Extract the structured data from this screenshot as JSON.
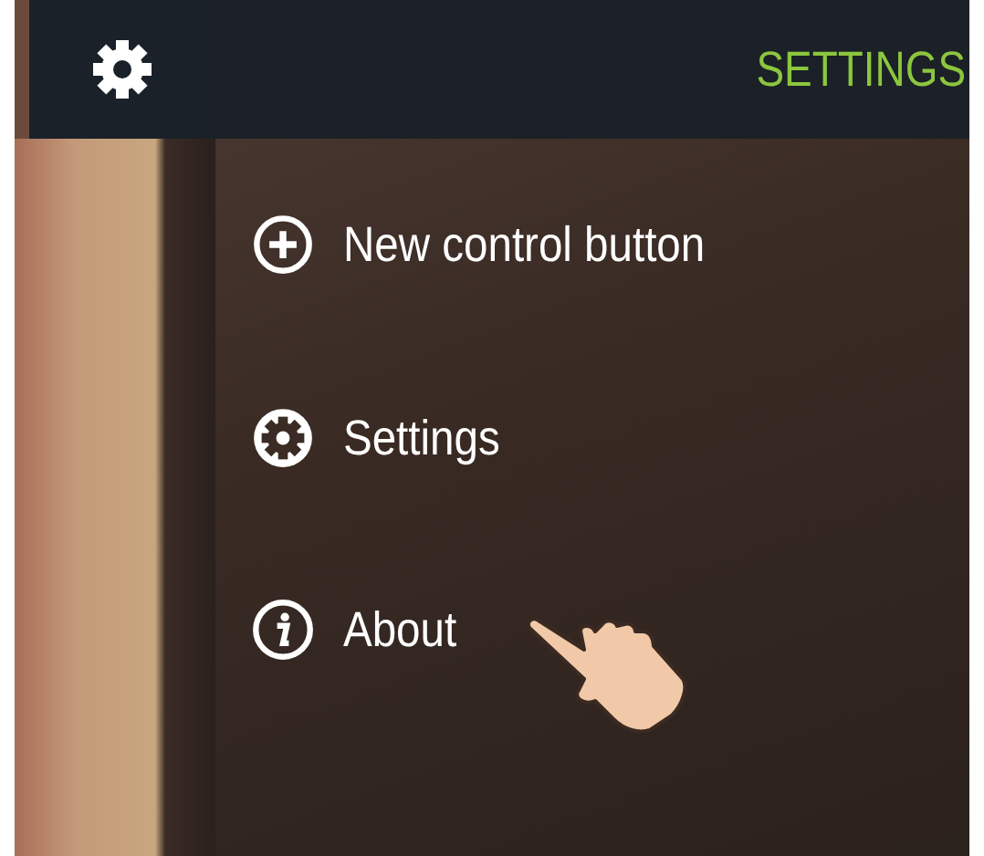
{
  "header": {
    "title": "SETTINGS"
  },
  "menu": [
    {
      "label": "New control button",
      "kind": "add"
    },
    {
      "label": "Settings",
      "kind": "settings"
    },
    {
      "label": "About",
      "kind": "info"
    }
  ]
}
